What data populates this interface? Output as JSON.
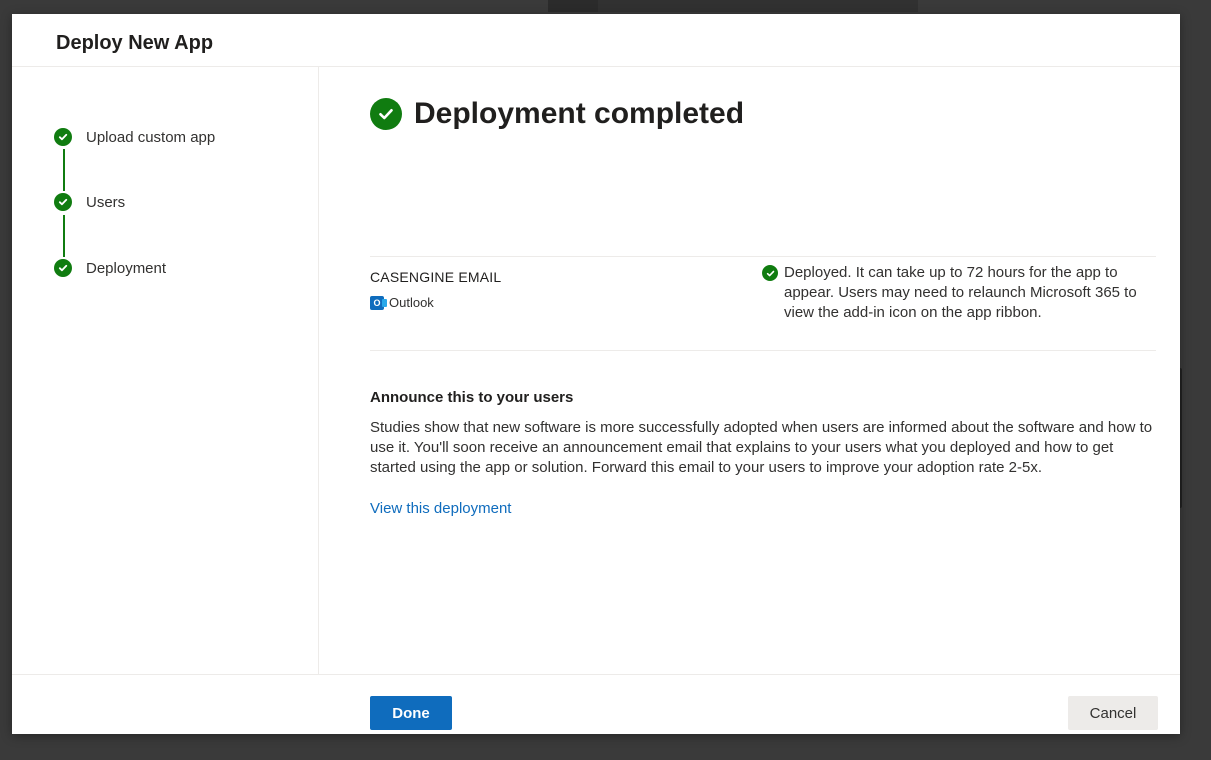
{
  "dialog": {
    "title": "Deploy New App"
  },
  "steps": [
    {
      "label": "Upload custom app",
      "status": "complete"
    },
    {
      "label": "Users",
      "status": "complete"
    },
    {
      "label": "Deployment",
      "status": "complete"
    }
  ],
  "main": {
    "title": "Deployment completed",
    "app": {
      "name": "CASENGINE EMAIL",
      "host": "Outlook",
      "status_text": "Deployed. It can take up to 72 hours for the app to appear. Users may need to relaunch Microsoft 365 to view the add-in icon on the app ribbon."
    },
    "announce": {
      "title": "Announce this to your users",
      "body": "Studies show that new software is more successfully adopted when users are informed about the software and how to use it. You'll soon receive an announcement email that explains to your users what you deployed and how to get started using the app or solution. Forward this email to your users to improve your adoption rate 2-5x.",
      "link": "View this deployment"
    }
  },
  "footer": {
    "done_label": "Done",
    "cancel_label": "Cancel"
  },
  "colors": {
    "success": "#107c10",
    "primary": "#0f6cbd",
    "secondary_button": "#edebe9"
  },
  "icons": {
    "check": "check-icon",
    "outlook": "outlook-icon"
  }
}
